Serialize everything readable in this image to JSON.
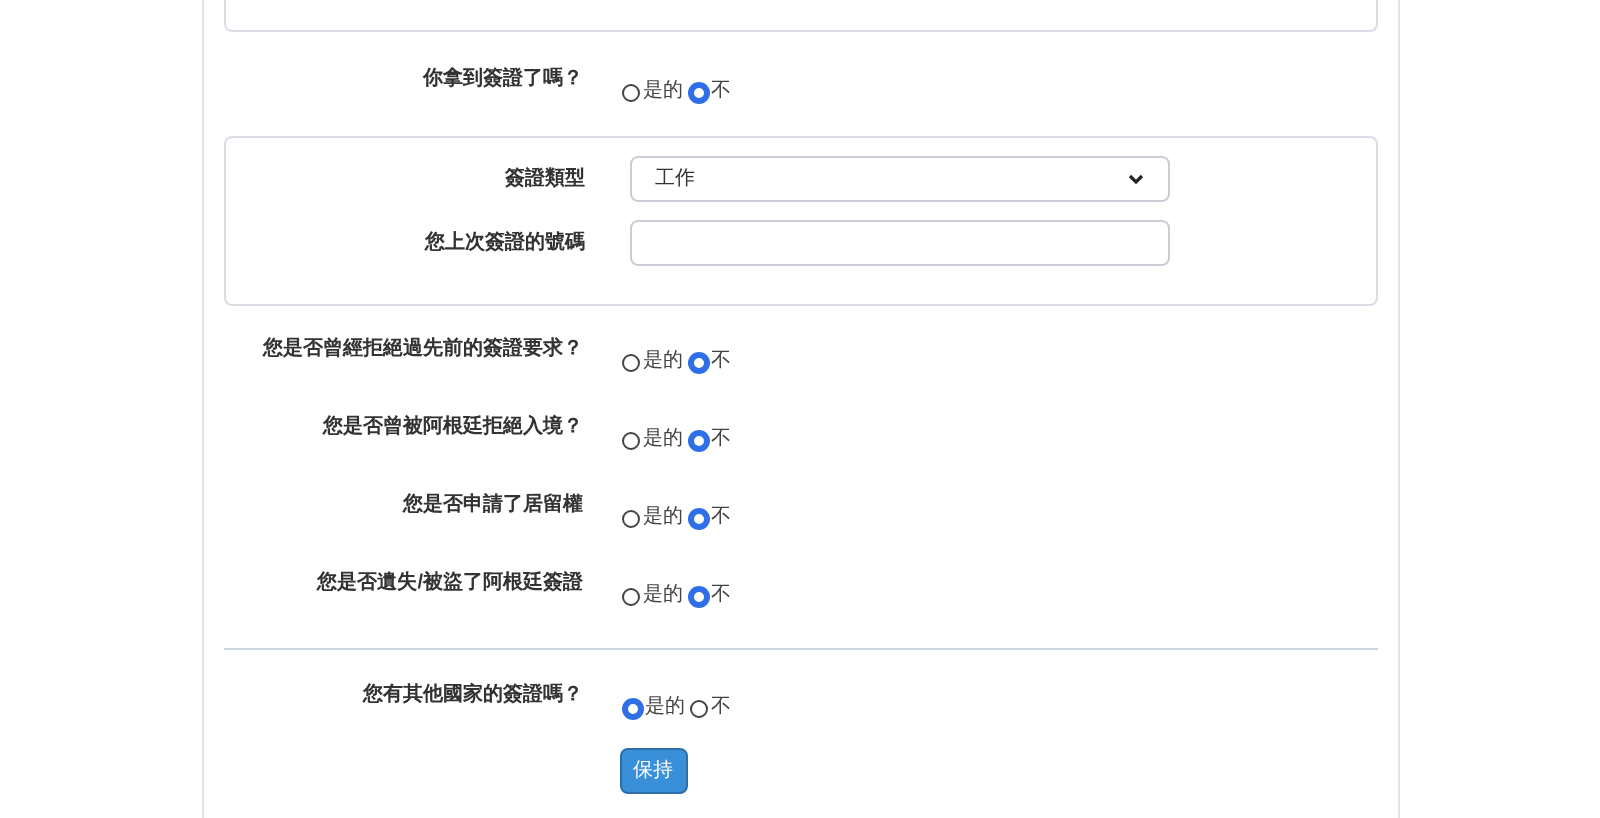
{
  "visa_question": {
    "label": "你拿到簽證了嗎？",
    "options": [
      {
        "label": "是的",
        "selected": false
      },
      {
        "label": "不",
        "selected": true
      }
    ]
  },
  "visa_details": {
    "type_label": "簽證類型",
    "type_value": "工作",
    "number_label": "您上次簽證的號碼"
  },
  "questions": [
    {
      "label": "您是否曾經拒絕過先前的簽證要求？",
      "options": [
        {
          "label": "是的",
          "selected": false
        },
        {
          "label": "不",
          "selected": true
        }
      ]
    },
    {
      "label": "您是否曾被阿根廷拒絕入境？",
      "options": [
        {
          "label": "是的",
          "selected": false
        },
        {
          "label": "不",
          "selected": true
        }
      ]
    },
    {
      "label": "您是否申請了居留權",
      "options": [
        {
          "label": "是的",
          "selected": false
        },
        {
          "label": "不",
          "selected": true
        }
      ]
    },
    {
      "label": "您是否遺失/被盜了阿根廷簽證",
      "options": [
        {
          "label": "是的",
          "selected": false
        },
        {
          "label": "不",
          "selected": true
        }
      ]
    }
  ],
  "other_visa_question": {
    "label": "您有其他國家的簽證嗎？",
    "options": [
      {
        "label": "是的",
        "selected": true
      },
      {
        "label": "不",
        "selected": false
      }
    ]
  },
  "save_button": "保持"
}
